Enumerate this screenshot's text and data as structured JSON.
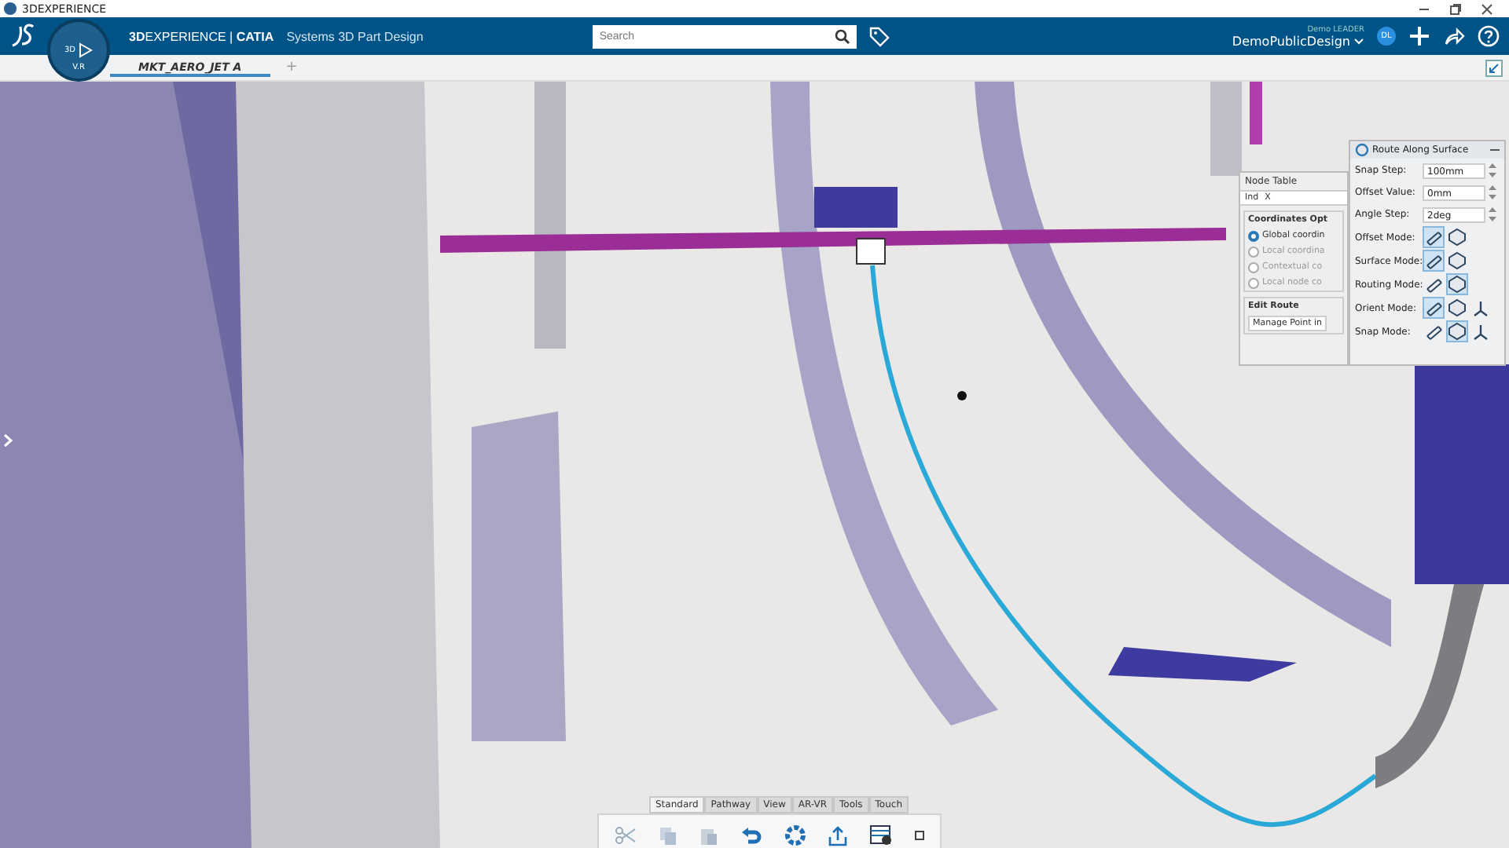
{
  "window": {
    "title": "3DEXPERIENCE"
  },
  "header": {
    "compass_labels": [
      "3D",
      "V.R"
    ],
    "brand": "**3D**EXPERIENCE | **CATIA**",
    "app": "Systems 3D Part Design",
    "search": {
      "placeholder": "Search"
    },
    "user_role": "Demo LEADER",
    "user_space": "DemoPublicDesign",
    "avatar": "DL"
  },
  "tabs": [
    {
      "label": "MKT_AERO_JET A",
      "selected": true
    }
  ],
  "add_tab": "+",
  "node_table": {
    "title": "Node Table",
    "columns": [
      "Ind",
      "X"
    ],
    "group": "Coordinates Opt",
    "options": [
      {
        "label": "Global coordin",
        "selected": true
      },
      {
        "label": "Local coordina",
        "selected": false
      },
      {
        "label": "Contextual co",
        "selected": false
      },
      {
        "label": "Local node co",
        "selected": false
      }
    ],
    "edit_group": "Edit Route",
    "edit_value": "Manage Point in"
  },
  "route_panel": {
    "title": "Route Along Surface",
    "rows": [
      {
        "kind": "spin",
        "label": "Snap Step:",
        "value": "100mm"
      },
      {
        "kind": "spin",
        "label": "Offset Value:",
        "value": "0mm"
      },
      {
        "kind": "spin",
        "label": "Angle Step:",
        "value": "2deg"
      },
      {
        "kind": "modes",
        "label": "Offset Mode:",
        "modes": [
          {
            "selected": true
          },
          {
            "selected": false
          }
        ]
      },
      {
        "kind": "modes",
        "label": "Surface Mode:",
        "modes": [
          {
            "selected": true
          },
          {
            "selected": false
          }
        ]
      },
      {
        "kind": "modes",
        "label": "Routing Mode:",
        "modes": [
          {
            "selected": false
          },
          {
            "selected": true
          }
        ]
      },
      {
        "kind": "modes",
        "label": "Orient Mode:",
        "modes": [
          {
            "selected": true
          },
          {
            "selected": false
          },
          {
            "selected": false
          }
        ]
      },
      {
        "kind": "modes",
        "label": "Snap Mode:",
        "modes": [
          {
            "selected": false
          },
          {
            "selected": true
          },
          {
            "selected": false
          }
        ]
      }
    ]
  },
  "toolbar": {
    "tabs": [
      {
        "label": "Standard",
        "selected": true
      },
      {
        "label": "Pathway",
        "selected": false
      },
      {
        "label": "View",
        "selected": false
      },
      {
        "label": "AR-VR",
        "selected": false
      },
      {
        "label": "Tools",
        "selected": false
      },
      {
        "label": "Touch",
        "selected": false
      }
    ]
  }
}
